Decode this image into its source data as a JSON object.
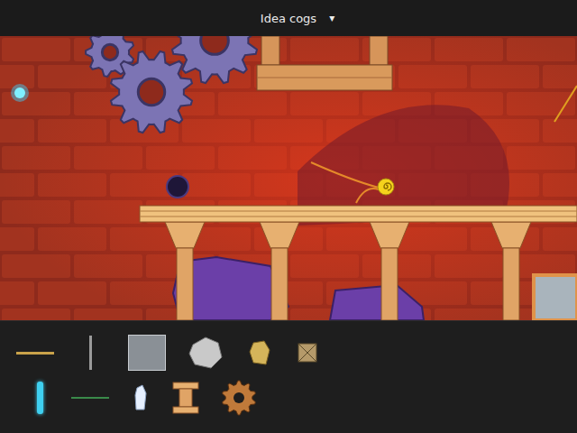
{
  "level_select": {
    "title": "Idea cogs",
    "arrow": "▾"
  },
  "palette": {
    "rows": [
      [
        {
          "kind": "rod"
        },
        {
          "kind": "pole"
        },
        {
          "kind": "plate"
        },
        {
          "kind": "rock"
        },
        {
          "kind": "nugget"
        },
        {
          "kind": "crate"
        }
      ],
      [
        {
          "kind": "tube"
        },
        {
          "kind": "wire"
        },
        {
          "kind": "crystal"
        },
        {
          "kind": "pillar"
        },
        {
          "kind": "gear"
        }
      ]
    ]
  }
}
